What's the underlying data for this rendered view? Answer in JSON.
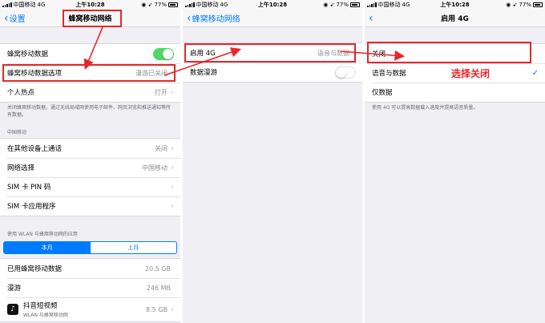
{
  "status_bar": {
    "carrier": "中国移动",
    "network": "4G",
    "time": "上午10:28",
    "battery": "77%"
  },
  "screen1": {
    "back_label": "设置",
    "title": "蜂窝移动网络",
    "rows_group1": [
      {
        "label": "蜂窝移动数据",
        "toggle": "on"
      },
      {
        "label": "蜂窝移动数据选项",
        "value": "漫游已关闭"
      },
      {
        "label": "个人热点",
        "value": "打开"
      }
    ],
    "note1": "关闭蜂窝移动数据，通过无线局域网使用电子邮件、网页浏览和推送通知等所有数据。",
    "section_carrier": "中国移动",
    "rows_group2": [
      {
        "label": "在其他设备上通话",
        "value": "关闭"
      },
      {
        "label": "网络选择",
        "value": "中国移动"
      },
      {
        "label": "SIM 卡 PIN 码",
        "value": ""
      },
      {
        "label": "SIM 卡应用程序",
        "value": ""
      }
    ],
    "section_usage": "使用 WLAN 与蜂窝移动网的应用",
    "segments": [
      "本月",
      "上月"
    ],
    "usage_rows": [
      {
        "label": "已用蜂窝移动数据",
        "value": "20.5 GB"
      },
      {
        "label": "漫游",
        "value": "246 MB"
      }
    ],
    "app": {
      "name": "抖音短视频",
      "subtitle": "WLAN 与蜂窝移动网",
      "size": "8.5 GB"
    }
  },
  "screen2": {
    "back_label": "蜂窝移动网络",
    "rows": [
      {
        "label": "启用 4G",
        "value": "语音与数据"
      },
      {
        "label": "数据漫游",
        "toggle": "off"
      }
    ]
  },
  "screen3": {
    "title": "启用 4G",
    "options": [
      {
        "label": "关闭",
        "checked": false
      },
      {
        "label": "语音与数据",
        "checked": true
      },
      {
        "label": "仅数据",
        "checked": false
      }
    ],
    "note": "使用 4G 可以提高数据载入速度并提高语音质量。"
  },
  "annotation": {
    "select_close": "选择关闭",
    "color": "#e6262a"
  },
  "colors": {
    "accent": "#007aff",
    "toggle_on": "#4cd964",
    "background": "#efeff4"
  }
}
